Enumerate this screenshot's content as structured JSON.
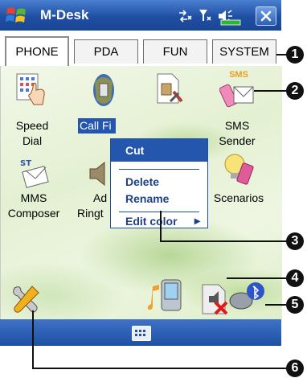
{
  "titlebar": {
    "title": "M-Desk"
  },
  "tabs": [
    {
      "label": "PHONE",
      "active": true
    },
    {
      "label": "PDA",
      "active": false
    },
    {
      "label": "FUN",
      "active": false
    },
    {
      "label": "SYSTEM",
      "active": false
    }
  ],
  "icons": {
    "speed_dial": {
      "line1": "Speed",
      "line2": "Dial"
    },
    "call_filter": {
      "label": "Call Fi"
    },
    "sms_sender": {
      "badge": "SMS",
      "line1": "SMS",
      "line2": "Sender"
    },
    "mms_composer": {
      "line1": "MMS",
      "line2": "Composer"
    },
    "add_ringtone": {
      "line1": "Ad",
      "line2": "Ringt"
    },
    "scenarios": {
      "label": "Scenarios"
    }
  },
  "context_menu": {
    "cut": "Cut",
    "delete": "Delete",
    "rename": "Rename",
    "edit_color": "Edit color",
    "edit_color_arrow": "▸"
  },
  "callouts": [
    "1",
    "2",
    "3",
    "4",
    "5",
    "6"
  ],
  "colors": {
    "titlebar": "#1f4fa3",
    "menu_text": "#1e3f8a",
    "callout": "#111111"
  }
}
